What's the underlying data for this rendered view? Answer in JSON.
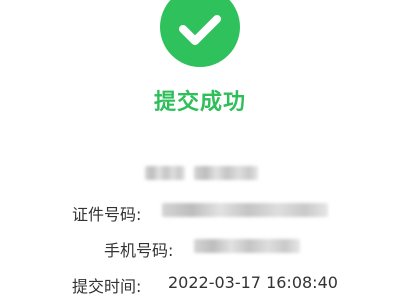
{
  "status": {
    "icon": "check-icon",
    "title": "提交成功",
    "colors": {
      "success_green": "#2fc15c",
      "text": "#333333"
    }
  },
  "details": {
    "id_label": "证件号码:",
    "phone_label": "手机号码:",
    "time_label": "提交时间:",
    "time_value": "2022-03-17 16:08:40"
  }
}
